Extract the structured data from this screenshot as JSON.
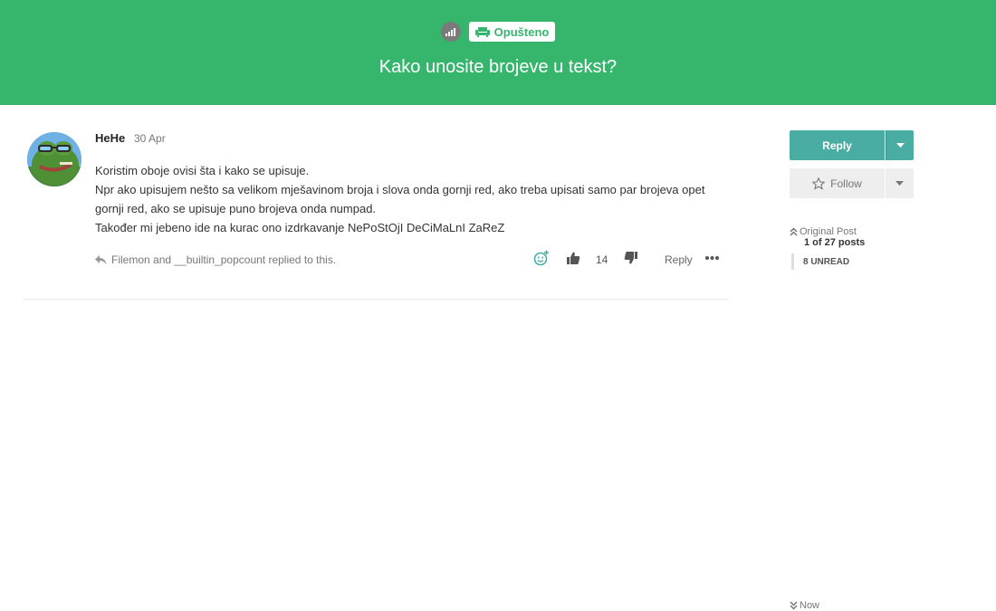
{
  "header": {
    "category": "Opušteno",
    "title": "Kako unosite brojeve u tekst?"
  },
  "post": {
    "author": "HeHe",
    "date": "30 Apr",
    "body": [
      "Koristim oboje ovisi šta i kako se upisuje.",
      "Npr ako upisujem nešto sa velikom mješavinom broja i slova onda gornji red, ako treba upisati samo par brojeva opet gornji red, ako se upisuje puno brojeva onda numpad.",
      "Također mi jebeno ide na kurac ono izdrkavanje NePoStOjI DeCiMaLnI ZaReZ"
    ],
    "replied_by": "Filemon and __builtin_popcount replied to this.",
    "votes": "14",
    "reply_label": "Reply"
  },
  "sidebar": {
    "reply_label": "Reply",
    "follow_label": "Follow",
    "original_post": "Original Post",
    "post_count": "1 of 27 posts",
    "unread": "8 UNREAD",
    "now": "Now"
  },
  "colors": {
    "header_bg": "#36b56d",
    "reply_btn": "#4aada3",
    "follow_btn": "#eeeeee"
  },
  "icons": [
    "signal-icon",
    "couch-icon",
    "reply-arrow-icon",
    "add-emoji-icon",
    "thumbs-up-icon",
    "thumbs-down-icon",
    "more-icon",
    "caret-down-icon",
    "star-icon",
    "double-chevron-up-icon",
    "double-chevron-down-icon"
  ]
}
